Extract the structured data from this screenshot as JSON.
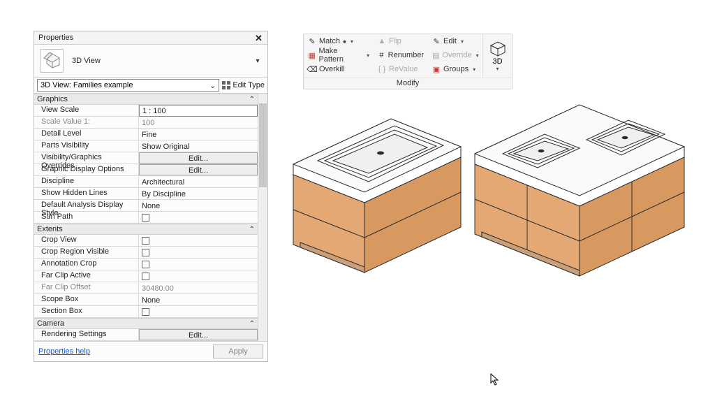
{
  "panel": {
    "title": "Properties",
    "type_label": "3D View",
    "selector": "3D View: Families example",
    "edit_type": "Edit Type",
    "sections": {
      "graphics": "Graphics",
      "extents": "Extents",
      "camera": "Camera"
    },
    "graphics": {
      "view_scale_label": "View Scale",
      "view_scale_value": "1 : 100",
      "scale_value_label": "Scale Value    1:",
      "scale_value_value": "100",
      "detail_level_label": "Detail Level",
      "detail_level_value": "Fine",
      "parts_vis_label": "Parts Visibility",
      "parts_vis_value": "Show Original",
      "vg_overrides_label": "Visibility/Graphics Overrides",
      "vg_overrides_btn": "Edit...",
      "gdisplay_label": "Graphic Display Options",
      "gdisplay_btn": "Edit...",
      "discipline_label": "Discipline",
      "discipline_value": "Architectural",
      "show_hidden_label": "Show Hidden Lines",
      "show_hidden_value": "By Discipline",
      "analysis_label": "Default Analysis Display Style",
      "analysis_value": "None",
      "sunpath_label": "Sun Path"
    },
    "extents": {
      "crop_view_label": "Crop View",
      "crop_region_label": "Crop Region Visible",
      "anno_crop_label": "Annotation Crop",
      "farclip_active_label": "Far Clip Active",
      "farclip_offset_label": "Far Clip Offset",
      "farclip_offset_value": "30480.00",
      "scope_box_label": "Scope Box",
      "scope_box_value": "None",
      "section_box_label": "Section Box"
    },
    "camera": {
      "render_label": "Rendering Settings",
      "render_btn": "Edit..."
    },
    "help": "Properties help",
    "apply": "Apply"
  },
  "ribbon": {
    "caption": "Modify",
    "match": "Match",
    "make_pattern": "Make Pattern",
    "overkill": "Overkill",
    "flip": "Flip",
    "renumber": "Renumber",
    "revalue": "ReValue",
    "edit": "Edit",
    "override": "Override",
    "groups": "Groups",
    "three_d": "3D"
  },
  "colors": {
    "wood": "#e3a873",
    "wood_edge": "#2b2b2b",
    "top_light": "#ffffff",
    "top_shadow": "#f0f0f0",
    "sink_line": "#2b2b2b"
  }
}
